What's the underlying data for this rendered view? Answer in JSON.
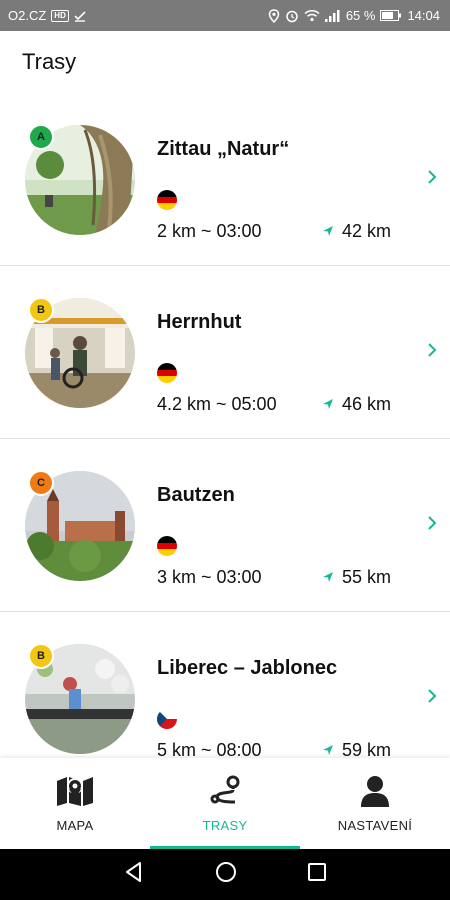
{
  "status_bar": {
    "carrier": "O2.CZ",
    "badge": "HD",
    "battery": "65 %",
    "time": "14:04"
  },
  "header": {
    "title": "Trasy"
  },
  "routes": [
    {
      "difficulty": "A",
      "badge_color": "#1fa94a",
      "name": "Zittau „Natur“",
      "flag": "germany-flag",
      "length": "2 km ~ 03:00",
      "distance": "42 km"
    },
    {
      "difficulty": "B",
      "badge_color": "#f3c613",
      "name": "Herrnhut",
      "flag": "germany-flag",
      "length": "4.2 km ~ 05:00",
      "distance": "46 km"
    },
    {
      "difficulty": "C",
      "badge_color": "#ee7b16",
      "name": "Bautzen",
      "flag": "germany-flag",
      "length": "3 km ~ 03:00",
      "distance": "55 km"
    },
    {
      "difficulty": "B",
      "badge_color": "#f3c613",
      "name": "Liberec – Jablonec",
      "flag": "czech-flag",
      "length": "5 km ~ 08:00",
      "distance": "59 km"
    }
  ],
  "nav": {
    "tabs": [
      {
        "label": "MAPA",
        "icon": "map-icon"
      },
      {
        "label": "TRASY",
        "icon": "route-icon",
        "active": true
      },
      {
        "label": "NASTAVENÍ",
        "icon": "person-icon"
      }
    ]
  },
  "colors": {
    "accent": "#16b894",
    "status_bar": "#7a7a7a"
  }
}
